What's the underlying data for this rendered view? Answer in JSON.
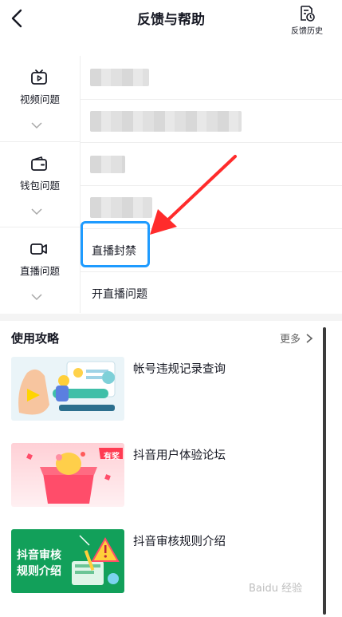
{
  "header": {
    "title": "反馈与帮助",
    "history_label": "反馈历史"
  },
  "categories": [
    {
      "label": "视频问题",
      "icon": "tv-icon"
    },
    {
      "label": "钱包问题",
      "icon": "wallet-icon"
    },
    {
      "label": "直播问题",
      "icon": "video-camera-icon"
    }
  ],
  "items": [
    {
      "label": "",
      "blurred": true
    },
    {
      "label": "",
      "blurred": true
    },
    {
      "label": "",
      "blurred": true
    },
    {
      "label": "",
      "blurred": true
    },
    {
      "label": "直播封禁",
      "highlighted": true
    },
    {
      "label": "开直播问题"
    }
  ],
  "guides": {
    "title": "使用攻略",
    "more_label": "更多",
    "list": [
      {
        "title": "帐号违规记录查询"
      },
      {
        "title": "抖音用户体验论坛",
        "badge": "有奖"
      },
      {
        "title": "抖音审核规则介绍",
        "thumb_text_1": "抖音审核",
        "thumb_text_2": "规则介绍"
      }
    ]
  },
  "watermark": "Baidu 经验",
  "colors": {
    "highlight": "#1e9bff",
    "arrow": "#ff2b2b",
    "text": "#161823"
  }
}
